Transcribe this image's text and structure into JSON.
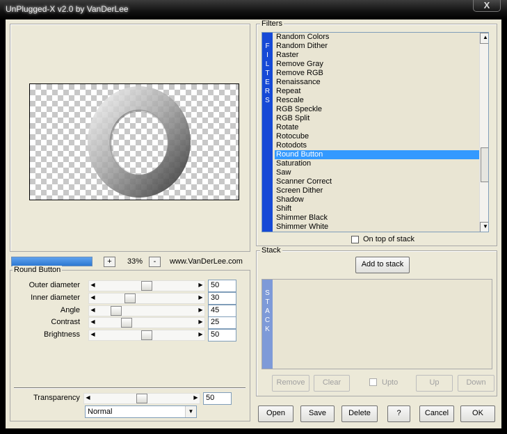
{
  "window": {
    "title": "UnPlugged-X v2.0 by VanDerLee",
    "close_label": "X"
  },
  "preview": {
    "zoom_minus": "-",
    "zoom_plus": "+",
    "zoom_value": "33%",
    "website": "www.VanDerLee.com",
    "progress": 1.0
  },
  "params": {
    "group_title": "Round Button",
    "rows": [
      {
        "label": "Outer diameter",
        "value": "50"
      },
      {
        "label": "Inner diameter",
        "value": "30"
      },
      {
        "label": "Angle",
        "value": "45"
      },
      {
        "label": "Contrast",
        "value": "25"
      },
      {
        "label": "Brightness",
        "value": "50"
      }
    ],
    "transparency": {
      "label": "Transparency",
      "value": "50"
    },
    "blend_mode": "Normal"
  },
  "filters": {
    "group_title": "Filters",
    "strip_letters": [
      "F",
      "I",
      "L",
      "T",
      "E",
      "R",
      "S"
    ],
    "items": [
      "Random Colors",
      "Random Dither",
      "Raster",
      "Remove Gray",
      "Remove RGB",
      "Renaissance",
      "Repeat",
      "Rescale",
      "RGB Speckle",
      "RGB Split",
      "Rotate",
      "Rotocube",
      "Rotodots",
      "Round Button",
      "Saturation",
      "Saw",
      "Scanner Correct",
      "Screen Dither",
      "Shadow",
      "Shift",
      "Shimmer Black",
      "Shimmer White"
    ],
    "selected": "Round Button",
    "on_top_label": "On top of stack"
  },
  "stack": {
    "group_title": "Stack",
    "add_label": "Add to stack",
    "strip_letters": [
      "S",
      "T",
      "A",
      "C",
      "K"
    ],
    "remove_label": "Remove",
    "clear_label": "Clear",
    "upto_label": "Upto",
    "up_label": "Up",
    "down_label": "Down"
  },
  "footer": {
    "open": "Open",
    "save": "Save",
    "delete": "Delete",
    "help": "?",
    "cancel": "Cancel",
    "ok": "OK"
  },
  "colors": {
    "selection": "#3399ff",
    "filters_strip": "#1649d6",
    "stack_strip": "#7e9ad8",
    "face": "#ece9d8"
  }
}
